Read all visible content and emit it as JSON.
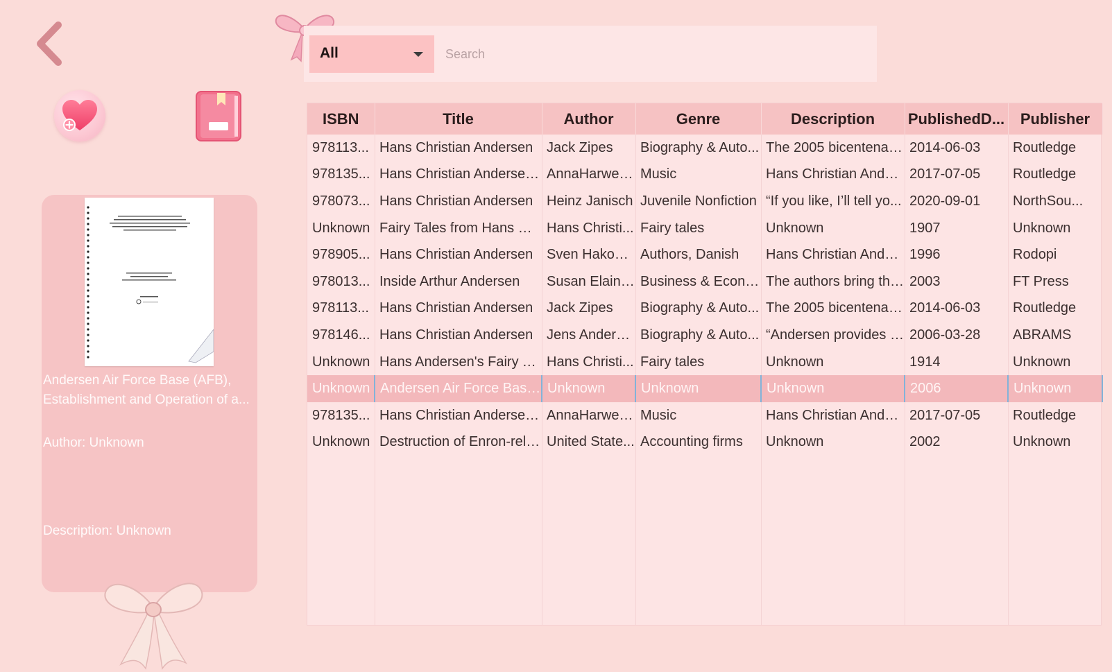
{
  "nav": {
    "back_icon": "chevron-left-icon",
    "favorite_icon": "heart-add-icon",
    "library_icon": "book-icon"
  },
  "filter": {
    "selected": "All"
  },
  "search": {
    "placeholder": "Search",
    "value": ""
  },
  "details": {
    "title_line1": "Andersen Air Force Base (AFB),",
    "title_line2": "Establishment and Operation of a...",
    "author": "Author: Unknown",
    "description": "Description: Unknown"
  },
  "table": {
    "columns": [
      "ISBN",
      "Title",
      "Author",
      "Genre",
      "Description",
      "PublishedD...",
      "Publisher"
    ],
    "rows": [
      [
        "978113...",
        "Hans Christian Andersen",
        "Jack Zipes",
        "Biography & Auto...",
        "The 2005 bicentenary...",
        "2014-06-03",
        "Routledge"
      ],
      [
        "978135...",
        "Hans Christian Andersen ...",
        "AnnaHarwell...",
        "Music",
        "Hans Christian Ander...",
        "2017-07-05",
        "Routledge"
      ],
      [
        "978073...",
        "Hans Christian Andersen",
        "Heinz Janisch",
        "Juvenile Nonfiction",
        "“If you like, I’ll tell yo...",
        "2020-09-01",
        "NorthSou..."
      ],
      [
        "Unknown",
        "Fairy Tales from Hans Chr...",
        "Hans Christi...",
        "Fairy tales",
        "Unknown",
        "1907",
        "Unknown"
      ],
      [
        "978905...",
        "Hans Christian Andersen",
        "Sven Hakon ...",
        "Authors, Danish",
        "Hans Christian Ander...",
        "1996",
        "Rodopi"
      ],
      [
        "978013...",
        "Inside Arthur Andersen",
        "Susan Elaine ...",
        "Business & Econo...",
        "The authors bring the...",
        "2003",
        "FT Press"
      ],
      [
        "978113...",
        "Hans Christian Andersen",
        "Jack Zipes",
        "Biography & Auto...",
        "The 2005 bicentenary...",
        "2014-06-03",
        "Routledge"
      ],
      [
        "978146...",
        "Hans Christian Andersen",
        "Jens Andersen",
        "Biography & Auto...",
        "“Andersen provides a...",
        "2006-03-28",
        "ABRAMS"
      ],
      [
        "Unknown",
        "Hans Andersen's Fairy Tal...",
        "Hans Christi...",
        "Fairy tales",
        "Unknown",
        "1914",
        "Unknown"
      ],
      [
        "Unknown",
        "Andersen Air Force Base (...",
        "Unknown",
        "Unknown",
        "Unknown",
        "2006",
        "Unknown"
      ],
      [
        "978135...",
        "Hans Christian Andersen ...",
        "AnnaHarwell...",
        "Music",
        "Hans Christian Ander...",
        "2017-07-05",
        "Routledge"
      ],
      [
        "Unknown",
        "Destruction of Enron-rela...",
        "United State...",
        "Accounting firms",
        "Unknown",
        "2002",
        "Unknown"
      ]
    ],
    "selected_row": 9
  },
  "colors": {
    "background": "#fbdcd9",
    "card": "#f6c4c5",
    "header": "#f6c2c3",
    "selected_row": "#f3b8bb",
    "accent": "#d98a92"
  }
}
